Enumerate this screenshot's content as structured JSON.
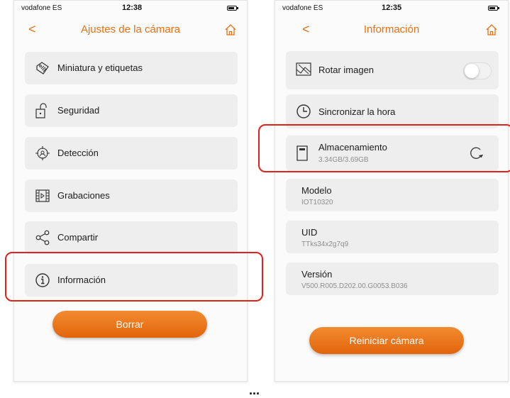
{
  "left_screen": {
    "status": {
      "carrier": "vodafone ES",
      "time": "12:38"
    },
    "nav": {
      "back": "<",
      "title": "Ajustes de la cámara"
    },
    "items": [
      {
        "label": "Miniatura y etiquetas"
      },
      {
        "label": "Seguridad"
      },
      {
        "label": "Detección"
      },
      {
        "label": "Grabaciones"
      },
      {
        "label": "Compartir"
      },
      {
        "label": "Información"
      }
    ],
    "delete_button": "Borrar"
  },
  "right_screen": {
    "status": {
      "carrier": "vodafone ES",
      "time": "12:35"
    },
    "nav": {
      "back": "<",
      "title": "Información"
    },
    "rotate": {
      "label": "Rotar imagen",
      "enabled": false
    },
    "sync_time": {
      "label": "Sincronizar la hora"
    },
    "storage": {
      "label": "Almacenamiento",
      "value": "3.34GB/3.69GB"
    },
    "model": {
      "label": "Modelo",
      "value": "IOT10320"
    },
    "uid": {
      "label": "UID",
      "value": "TTks34x2g7q9"
    },
    "version": {
      "label": "Versión",
      "value": "V500.R005.D202.00.G0053.B036"
    },
    "restart_button": "Reiniciar cámara"
  },
  "ellipsis": "...",
  "colors": {
    "accent": "#e96f12",
    "highlight": "#e0221e",
    "card": "#eeeeef"
  }
}
